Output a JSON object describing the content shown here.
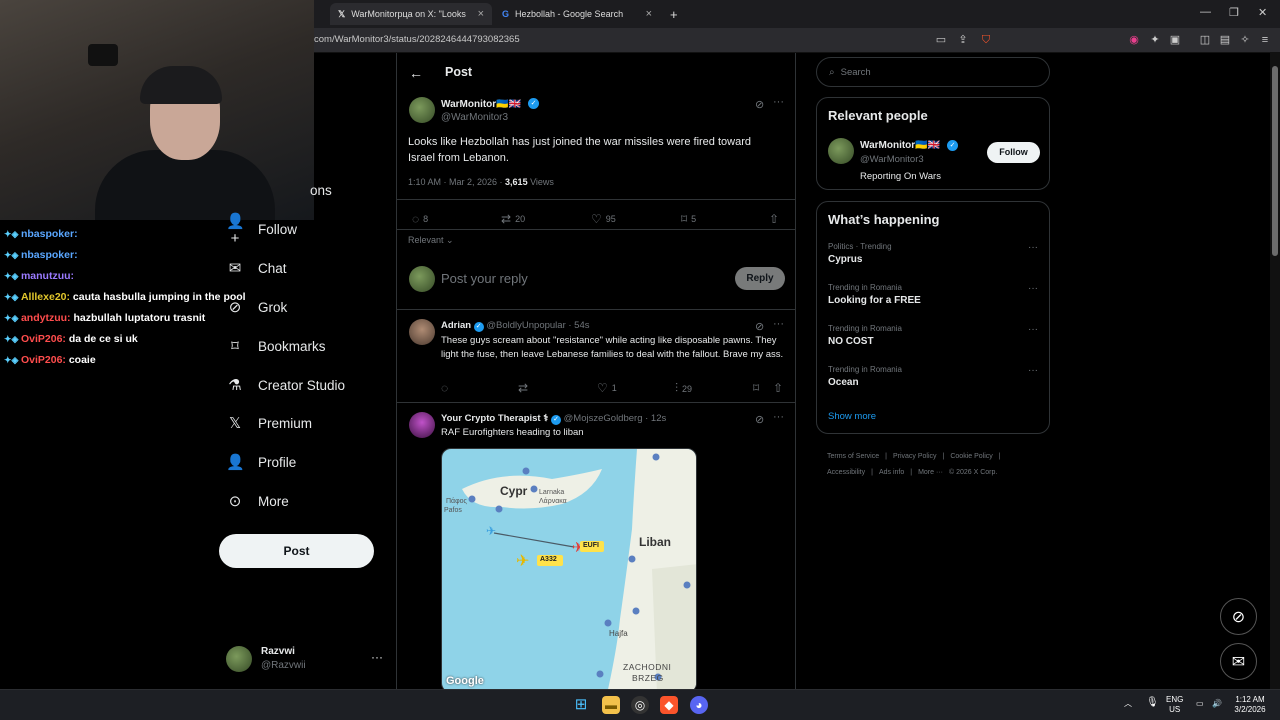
{
  "browser": {
    "tabs": [
      {
        "label": "WarMonitorрца on X: \"Looks lik",
        "icon": "x-logo-icon"
      },
      {
        "label": "Hezbollah - Google Search",
        "icon": "google-icon"
      }
    ],
    "url": "com/WarMonitor3/status/2028246444793082365"
  },
  "chat": [
    {
      "user": "nbaspoker:",
      "color": "#5aa7ff",
      "message": ""
    },
    {
      "user": "nbaspoker:",
      "color": "#5aa7ff",
      "message": ""
    },
    {
      "user": "manutzuu:",
      "color": "#9b7bff",
      "message": ""
    },
    {
      "user": "Alllexe20:",
      "color": "#e2c72c",
      "message": "cauta hasbulla jumping in the pool"
    },
    {
      "user": "andytzuu:",
      "color": "#ff4d4d",
      "message": "hazbullah luptatoru trasnit"
    },
    {
      "user": "OviP206:",
      "color": "#ff4d4d",
      "message": "da de ce si uk"
    },
    {
      "user": "OviP206:",
      "color": "#ff4d4d",
      "message": "coaie"
    }
  ],
  "nav": {
    "partial": "ons",
    "items": [
      {
        "label": "Follow",
        "icon": "add-person-icon"
      },
      {
        "label": "Chat",
        "icon": "mail-icon"
      },
      {
        "label": "Grok",
        "icon": "grok-icon"
      },
      {
        "label": "Bookmarks",
        "icon": "bookmark-icon"
      },
      {
        "label": "Creator Studio",
        "icon": "flask-icon"
      },
      {
        "label": "Premium",
        "icon": "x-logo-icon"
      },
      {
        "label": "Profile",
        "icon": "person-icon"
      },
      {
        "label": "More",
        "icon": "more-circle-icon"
      }
    ],
    "post_button": "Post",
    "account": {
      "name": "Razvwi",
      "handle": "@Razvwii"
    }
  },
  "post": {
    "header": "Post",
    "author": "WarMonitor🇺🇦🇬🇧",
    "handle": "@WarMonitor3",
    "text": "Looks like Hezbollah has just joined the war missiles were fired toward Israel from Lebanon.",
    "time": "1:10 AM · Mar 2, 2026 · ",
    "views_count": "3,615",
    "views_label": " Views",
    "stats": {
      "replies": "8",
      "reposts": "20",
      "likes": "95",
      "bookmarks": "5"
    },
    "sort": "Relevant",
    "reply_placeholder": "Post your reply",
    "reply_button": "Reply"
  },
  "replies": [
    {
      "author": "Adrian",
      "handle": "@BoldlyUnpopular · 54s",
      "text": "These guys scream about \"resistance\" while acting like disposable pawns. They light the fuse, then leave Lebanese families to deal with the fallout. Brave my ass.",
      "likes": "1",
      "views": "29"
    },
    {
      "author": "Your Crypto Therapist ⚕",
      "handle": "@MojszeGoldberg · 12s",
      "text": "RAF Eurofighters heading to liban"
    }
  ],
  "map": {
    "labels": [
      "Cypr",
      "Larnaka",
      "Λάρνακα",
      "Πάφος",
      "Pafos",
      "Liban",
      "Hajfa",
      "ZACHODNI",
      "BRZEG",
      "EUFI",
      "A332"
    ],
    "attribution": "Google"
  },
  "right": {
    "search_placeholder": "Search",
    "relevant_title": "Relevant people",
    "person": {
      "name": "WarMonitor🇺🇦🇬🇧",
      "handle": "@WarMonitor3",
      "bio": "Reporting On Wars",
      "follow": "Follow"
    },
    "happening_title": "What’s happening",
    "trends": [
      {
        "category": "Politics · Trending",
        "name": "Cyprus"
      },
      {
        "category": "Trending in Romania",
        "name": "Looking for a FREE"
      },
      {
        "category": "Trending in Romania",
        "name": "NO COST"
      },
      {
        "category": "Trending in Romania",
        "name": "Ocean"
      }
    ],
    "show_more": "Show more",
    "footer": [
      "Terms of Service",
      "|",
      "Privacy Policy",
      "|",
      "Cookie Policy",
      "|",
      "Accessibility",
      "|",
      "Ads info",
      "|",
      "More ···",
      "© 2026 X Corp."
    ]
  },
  "taskbar": {
    "lang": "ENG",
    "region": "US",
    "time": "1:12 AM",
    "date": "3/2/2026"
  },
  "colors": {
    "accent": "#1d9bf0",
    "background": "#000000",
    "border": "#2f3336",
    "muted": "#71767b"
  }
}
